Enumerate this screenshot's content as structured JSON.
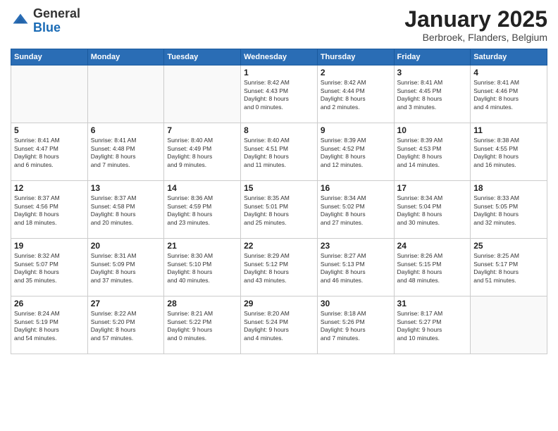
{
  "header": {
    "logo_general": "General",
    "logo_blue": "Blue",
    "month_title": "January 2025",
    "location": "Berbroek, Flanders, Belgium"
  },
  "weekdays": [
    "Sunday",
    "Monday",
    "Tuesday",
    "Wednesday",
    "Thursday",
    "Friday",
    "Saturday"
  ],
  "weeks": [
    [
      {
        "day": "",
        "info": ""
      },
      {
        "day": "",
        "info": ""
      },
      {
        "day": "",
        "info": ""
      },
      {
        "day": "1",
        "info": "Sunrise: 8:42 AM\nSunset: 4:43 PM\nDaylight: 8 hours\nand 0 minutes."
      },
      {
        "day": "2",
        "info": "Sunrise: 8:42 AM\nSunset: 4:44 PM\nDaylight: 8 hours\nand 2 minutes."
      },
      {
        "day": "3",
        "info": "Sunrise: 8:41 AM\nSunset: 4:45 PM\nDaylight: 8 hours\nand 3 minutes."
      },
      {
        "day": "4",
        "info": "Sunrise: 8:41 AM\nSunset: 4:46 PM\nDaylight: 8 hours\nand 4 minutes."
      }
    ],
    [
      {
        "day": "5",
        "info": "Sunrise: 8:41 AM\nSunset: 4:47 PM\nDaylight: 8 hours\nand 6 minutes."
      },
      {
        "day": "6",
        "info": "Sunrise: 8:41 AM\nSunset: 4:48 PM\nDaylight: 8 hours\nand 7 minutes."
      },
      {
        "day": "7",
        "info": "Sunrise: 8:40 AM\nSunset: 4:49 PM\nDaylight: 8 hours\nand 9 minutes."
      },
      {
        "day": "8",
        "info": "Sunrise: 8:40 AM\nSunset: 4:51 PM\nDaylight: 8 hours\nand 11 minutes."
      },
      {
        "day": "9",
        "info": "Sunrise: 8:39 AM\nSunset: 4:52 PM\nDaylight: 8 hours\nand 12 minutes."
      },
      {
        "day": "10",
        "info": "Sunrise: 8:39 AM\nSunset: 4:53 PM\nDaylight: 8 hours\nand 14 minutes."
      },
      {
        "day": "11",
        "info": "Sunrise: 8:38 AM\nSunset: 4:55 PM\nDaylight: 8 hours\nand 16 minutes."
      }
    ],
    [
      {
        "day": "12",
        "info": "Sunrise: 8:37 AM\nSunset: 4:56 PM\nDaylight: 8 hours\nand 18 minutes."
      },
      {
        "day": "13",
        "info": "Sunrise: 8:37 AM\nSunset: 4:58 PM\nDaylight: 8 hours\nand 20 minutes."
      },
      {
        "day": "14",
        "info": "Sunrise: 8:36 AM\nSunset: 4:59 PM\nDaylight: 8 hours\nand 23 minutes."
      },
      {
        "day": "15",
        "info": "Sunrise: 8:35 AM\nSunset: 5:01 PM\nDaylight: 8 hours\nand 25 minutes."
      },
      {
        "day": "16",
        "info": "Sunrise: 8:34 AM\nSunset: 5:02 PM\nDaylight: 8 hours\nand 27 minutes."
      },
      {
        "day": "17",
        "info": "Sunrise: 8:34 AM\nSunset: 5:04 PM\nDaylight: 8 hours\nand 30 minutes."
      },
      {
        "day": "18",
        "info": "Sunrise: 8:33 AM\nSunset: 5:05 PM\nDaylight: 8 hours\nand 32 minutes."
      }
    ],
    [
      {
        "day": "19",
        "info": "Sunrise: 8:32 AM\nSunset: 5:07 PM\nDaylight: 8 hours\nand 35 minutes."
      },
      {
        "day": "20",
        "info": "Sunrise: 8:31 AM\nSunset: 5:09 PM\nDaylight: 8 hours\nand 37 minutes."
      },
      {
        "day": "21",
        "info": "Sunrise: 8:30 AM\nSunset: 5:10 PM\nDaylight: 8 hours\nand 40 minutes."
      },
      {
        "day": "22",
        "info": "Sunrise: 8:29 AM\nSunset: 5:12 PM\nDaylight: 8 hours\nand 43 minutes."
      },
      {
        "day": "23",
        "info": "Sunrise: 8:27 AM\nSunset: 5:13 PM\nDaylight: 8 hours\nand 46 minutes."
      },
      {
        "day": "24",
        "info": "Sunrise: 8:26 AM\nSunset: 5:15 PM\nDaylight: 8 hours\nand 48 minutes."
      },
      {
        "day": "25",
        "info": "Sunrise: 8:25 AM\nSunset: 5:17 PM\nDaylight: 8 hours\nand 51 minutes."
      }
    ],
    [
      {
        "day": "26",
        "info": "Sunrise: 8:24 AM\nSunset: 5:19 PM\nDaylight: 8 hours\nand 54 minutes."
      },
      {
        "day": "27",
        "info": "Sunrise: 8:22 AM\nSunset: 5:20 PM\nDaylight: 8 hours\nand 57 minutes."
      },
      {
        "day": "28",
        "info": "Sunrise: 8:21 AM\nSunset: 5:22 PM\nDaylight: 9 hours\nand 0 minutes."
      },
      {
        "day": "29",
        "info": "Sunrise: 8:20 AM\nSunset: 5:24 PM\nDaylight: 9 hours\nand 4 minutes."
      },
      {
        "day": "30",
        "info": "Sunrise: 8:18 AM\nSunset: 5:26 PM\nDaylight: 9 hours\nand 7 minutes."
      },
      {
        "day": "31",
        "info": "Sunrise: 8:17 AM\nSunset: 5:27 PM\nDaylight: 9 hours\nand 10 minutes."
      },
      {
        "day": "",
        "info": ""
      }
    ]
  ]
}
